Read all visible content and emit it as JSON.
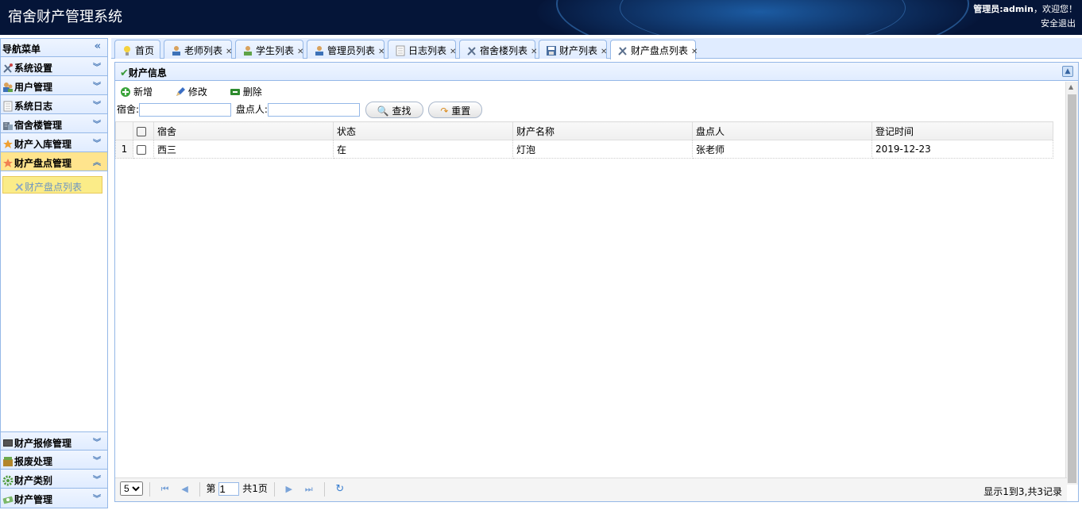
{
  "header": {
    "title": "宿舍财产管理系统",
    "user_prefix": "管理员:",
    "user_name": "admin",
    "welcome": "，欢迎您！",
    "logout": "安全退出"
  },
  "sidebar": {
    "title": "导航菜单",
    "sections": [
      {
        "label": "系统设置",
        "icon": "tools-icon"
      },
      {
        "label": "用户管理",
        "icon": "users-icon"
      },
      {
        "label": "系统日志",
        "icon": "log-icon"
      },
      {
        "label": "宿舍楼管理",
        "icon": "building-icon"
      },
      {
        "label": "财产入库管理",
        "icon": "star-icon"
      },
      {
        "label": "财产盘点管理",
        "icon": "star-icon"
      }
    ],
    "active_item": "财产盘点列表",
    "bottom_sections": [
      {
        "label": "财产报修管理",
        "icon": "monitor-icon"
      },
      {
        "label": "报废处理",
        "icon": "box-icon"
      },
      {
        "label": "财产类别",
        "icon": "gear-icon"
      },
      {
        "label": "财产管理",
        "icon": "money-icon"
      }
    ]
  },
  "tabs": [
    {
      "label": "首页",
      "icon": "bulb-icon",
      "closable": false
    },
    {
      "label": "老师列表",
      "icon": "user-icon",
      "closable": true
    },
    {
      "label": "学生列表",
      "icon": "user-icon",
      "closable": true
    },
    {
      "label": "管理员列表",
      "icon": "user-icon",
      "closable": true
    },
    {
      "label": "日志列表",
      "icon": "doc-icon",
      "closable": true
    },
    {
      "label": "宿舍楼列表",
      "icon": "tools-icon",
      "closable": true
    },
    {
      "label": "财产列表",
      "icon": "save-icon",
      "closable": true
    },
    {
      "label": "财产盘点列表",
      "icon": "tools-icon",
      "closable": true
    }
  ],
  "panel": {
    "title": "财产信息",
    "toolbar": {
      "add": "新增",
      "edit": "修改",
      "delete": "删除"
    },
    "search": {
      "dorm_label": "宿舍:",
      "checker_label": "盘点人:",
      "search_btn": "查找",
      "reset_btn": "重置"
    },
    "columns": [
      "宿舍",
      "状态",
      "财产名称",
      "盘点人",
      "登记时间"
    ],
    "rows": [
      {
        "num": "1",
        "cells": [
          "西三",
          "在",
          "灯泡",
          "张老师",
          "2019-12-23"
        ]
      }
    ],
    "pager": {
      "page_size": "5",
      "page_prefix": "第",
      "page_value": "1",
      "page_suffix": "共1页",
      "info": "显示1到3,共3记录"
    }
  },
  "colors": {
    "header_bg": "#051538",
    "accent_border": "#95b8e7",
    "panel_head": "#e0ecff",
    "active_item": "#ffe48d"
  }
}
